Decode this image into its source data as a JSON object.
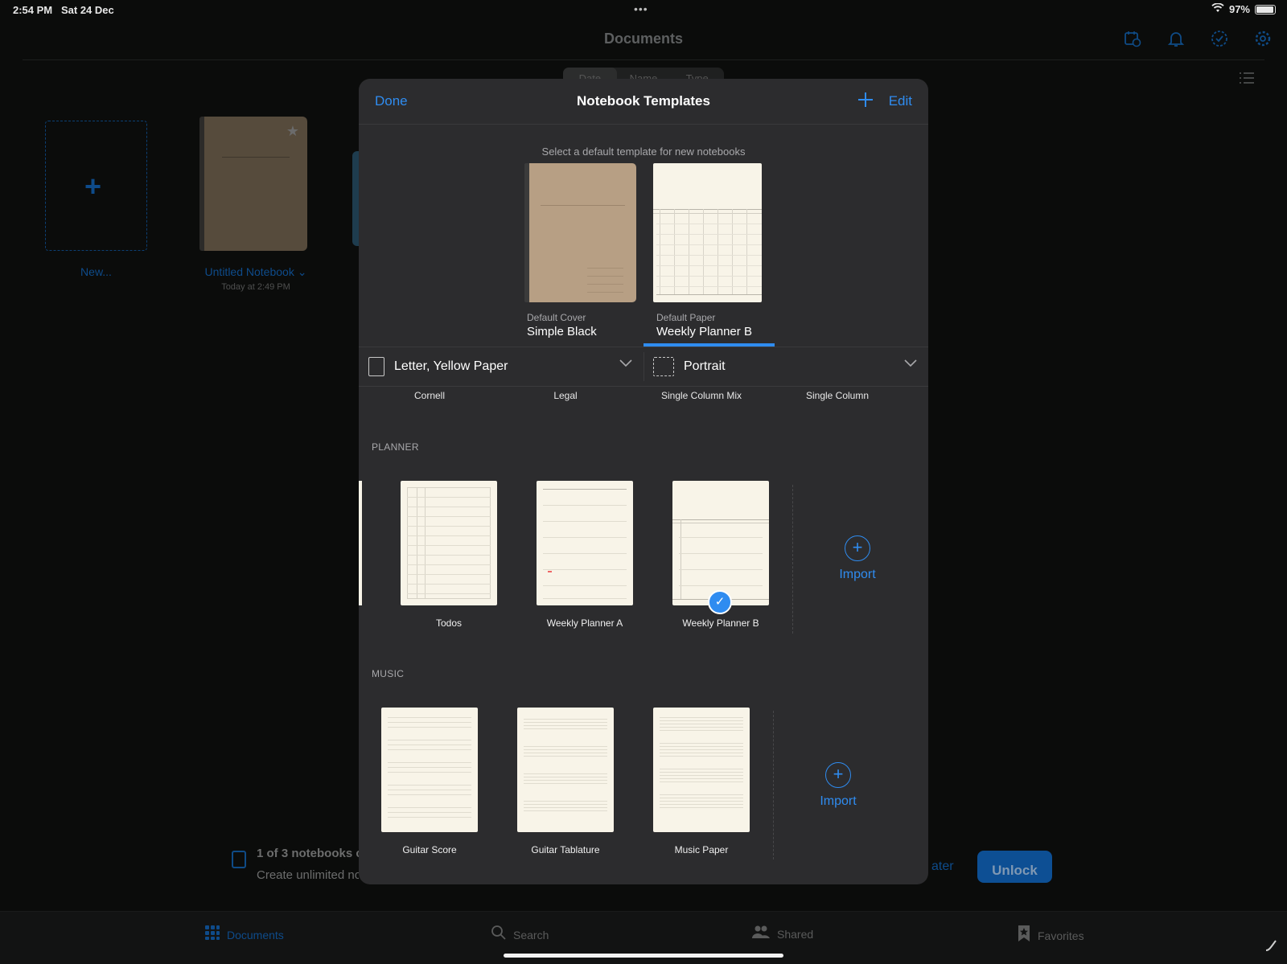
{
  "status_bar": {
    "time": "2:54 PM",
    "date": "Sat 24 Dec",
    "dots": "•••",
    "battery": "97%"
  },
  "header": {
    "title": "Documents"
  },
  "top_icons": [
    "calendar-clock-icon",
    "bell-icon",
    "check-circle-icon",
    "gear-icon"
  ],
  "sort_tabs": [
    "Date",
    "Name",
    "Type"
  ],
  "library": {
    "new_label": "New...",
    "notebook_title": "Untitled Notebook ⌄",
    "notebook_date": "Today at 2:49 PM"
  },
  "promo": {
    "title": "1 of 3 notebooks c",
    "subtitle": "Create unlimited no",
    "later": "ater",
    "unlock": "Unlock"
  },
  "tabbar": [
    {
      "label": "Documents",
      "icon": "grid-icon"
    },
    {
      "label": "Search",
      "icon": "search-icon"
    },
    {
      "label": "Shared",
      "icon": "people-icon"
    },
    {
      "label": "Favorites",
      "icon": "bookmark-star-icon"
    }
  ],
  "modal": {
    "done": "Done",
    "title": "Notebook Templates",
    "plus": "+",
    "edit": "Edit",
    "hint": "Select a default template for new notebooks",
    "default_cover_label": "Default Cover",
    "default_cover_value": "Simple Black",
    "default_paper_label": "Default Paper",
    "default_paper_value": "Weekly Planner B",
    "paper_size": "Letter, Yellow Paper",
    "orientation": "Portrait",
    "top_row_labels": [
      "Cornell",
      "Legal",
      "Single Column Mix",
      "Single Column"
    ],
    "planner_section": "PLANNER",
    "planner_items": [
      "Todos",
      "Weekly Planner A",
      "Weekly Planner B"
    ],
    "music_section": "MUSIC",
    "music_items": [
      "Guitar Score",
      "Guitar Tablature",
      "Music Paper"
    ],
    "import": "Import",
    "selected_template": "Weekly Planner B"
  },
  "colors": {
    "accent": "#2f8cf0",
    "modal_bg": "#2c2c2e",
    "paper": "#f8f4e8",
    "cover": "#b79f84"
  }
}
